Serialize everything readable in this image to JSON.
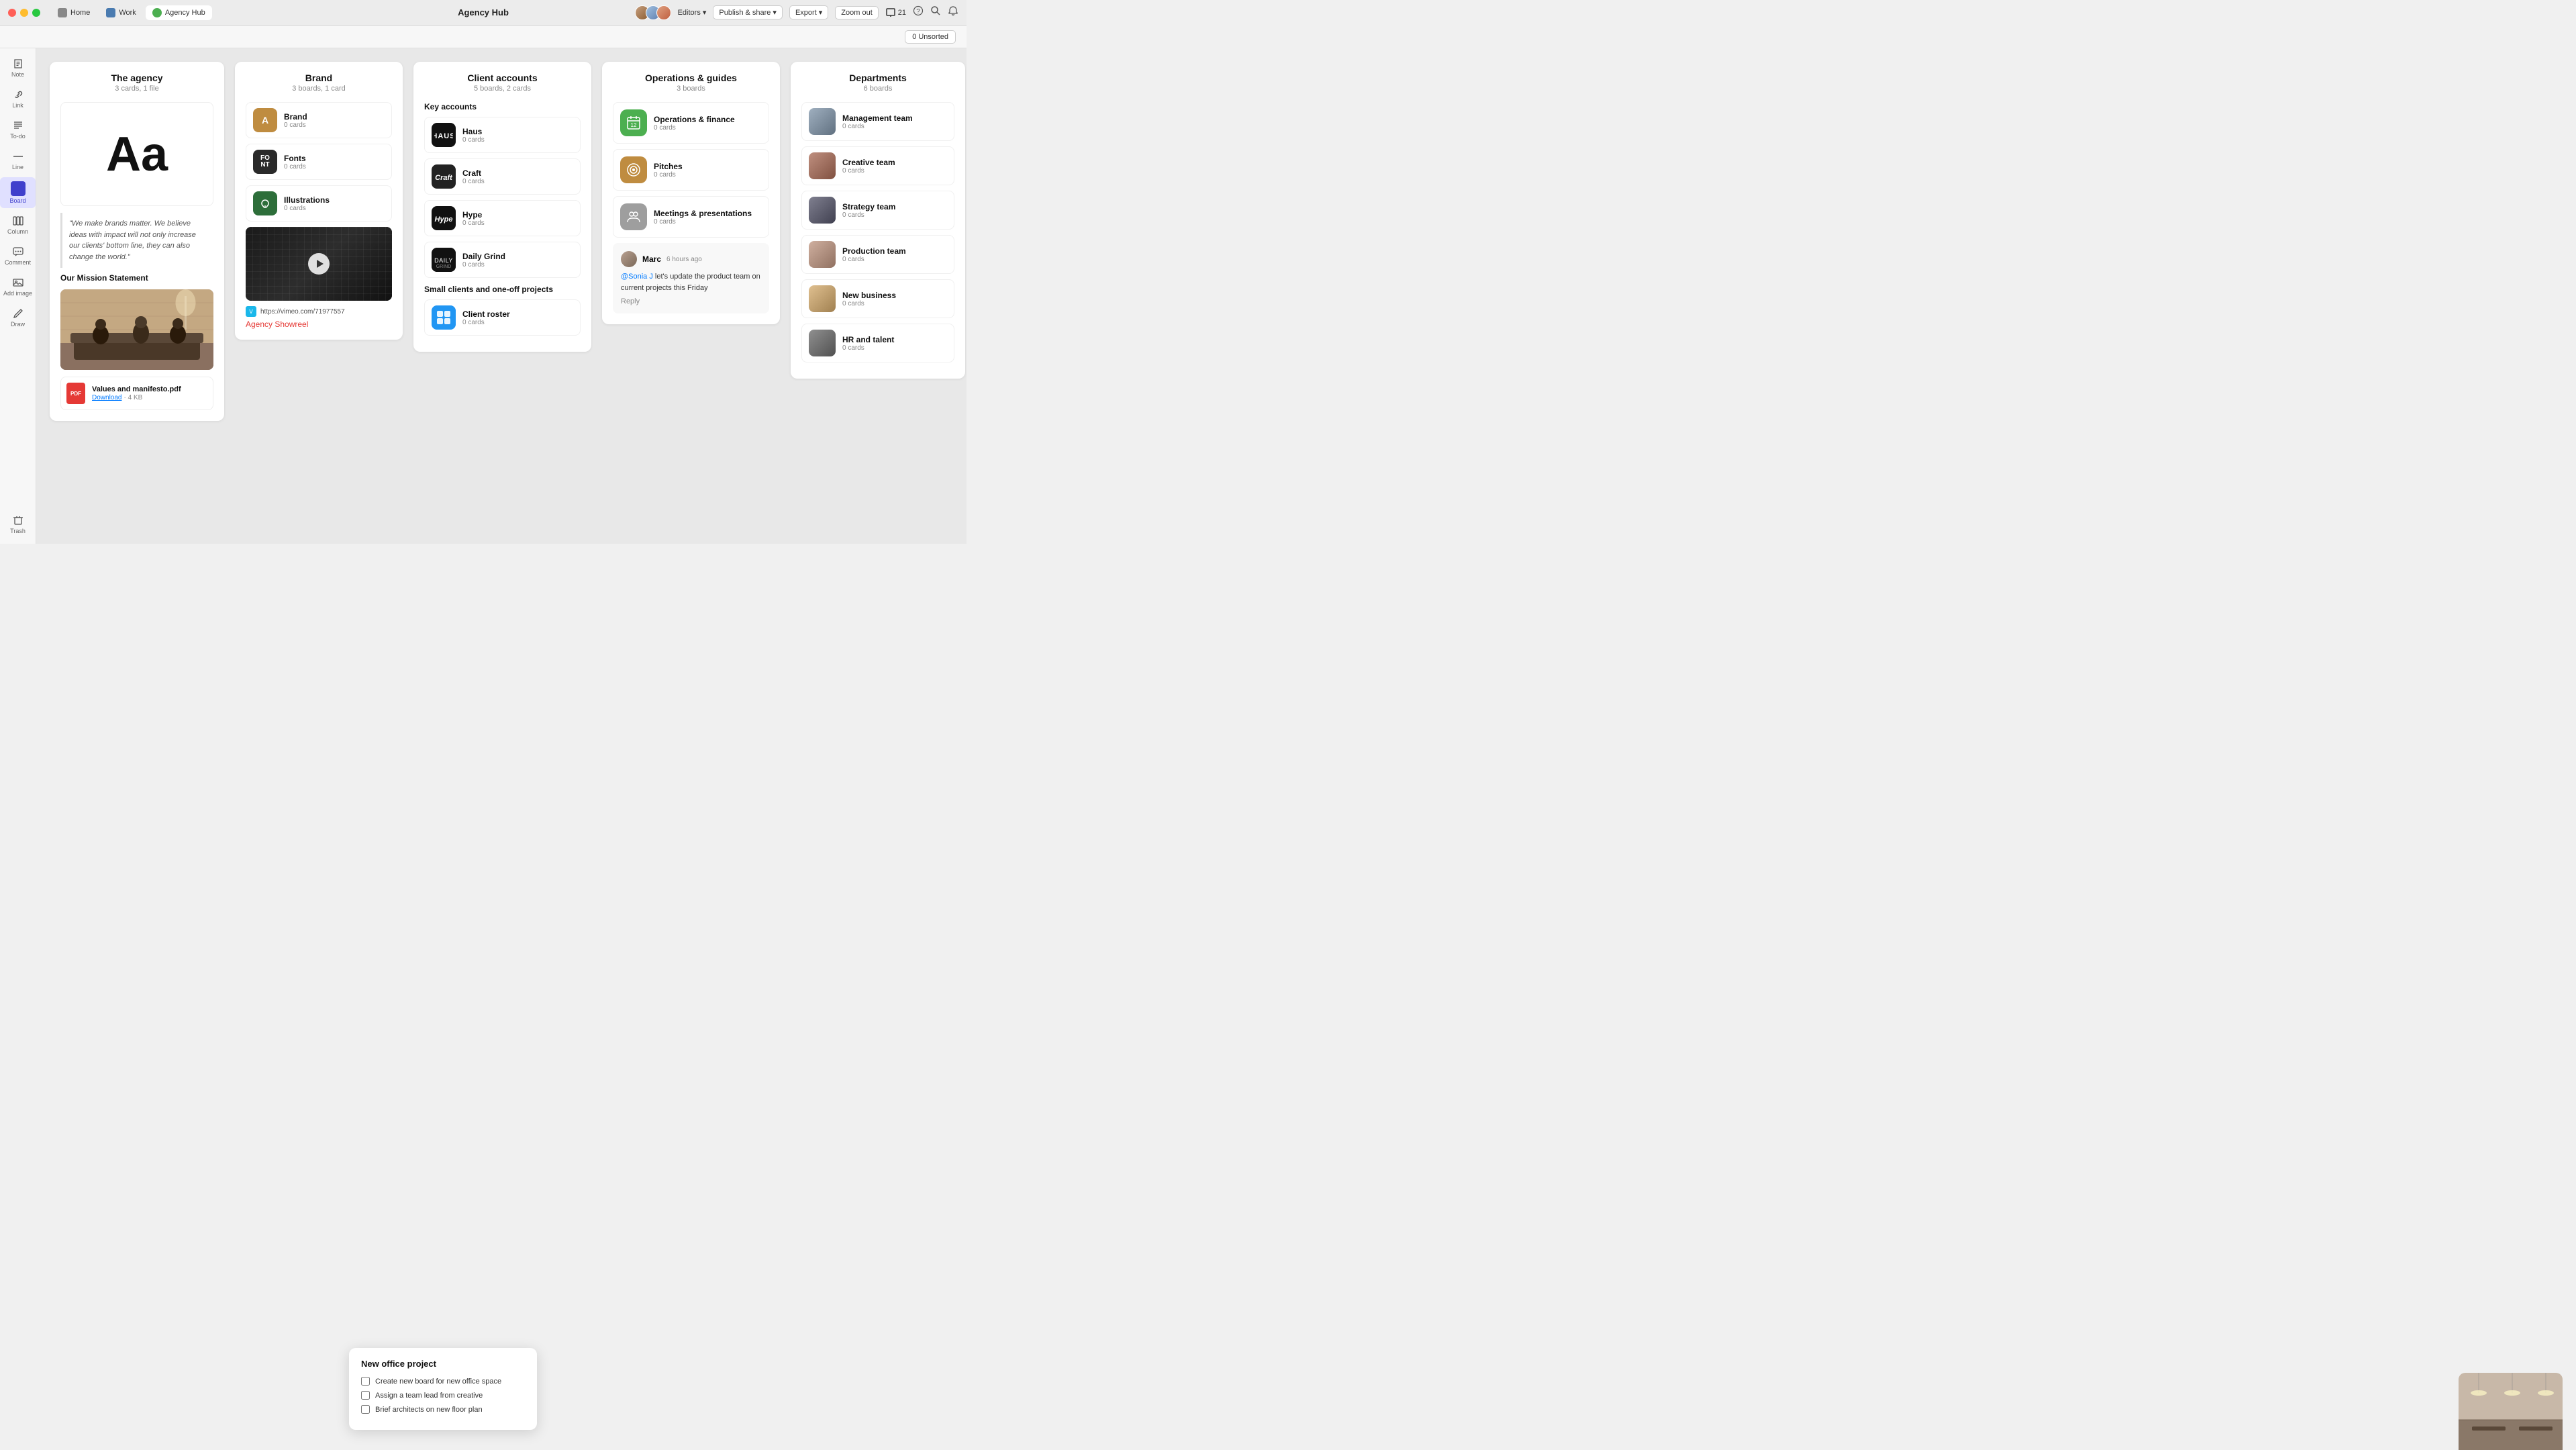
{
  "titleBar": {
    "title": "Agency Hub",
    "tabs": [
      {
        "label": "Home",
        "iconType": "home",
        "active": false
      },
      {
        "label": "Work",
        "iconType": "work",
        "active": false
      },
      {
        "label": "Agency Hub",
        "iconType": "agency",
        "active": true
      }
    ],
    "editors": "Editors",
    "publishShare": "Publish & share",
    "export": "Export",
    "zoomOut": "Zoom out",
    "notifications": "21"
  },
  "topBar": {
    "unsorted": "0 Unsorted"
  },
  "sidebar": {
    "items": [
      {
        "label": "Note",
        "icon": "note-icon"
      },
      {
        "label": "Link",
        "icon": "link-icon"
      },
      {
        "label": "To-do",
        "icon": "todo-icon"
      },
      {
        "label": "Line",
        "icon": "line-icon"
      },
      {
        "label": "Board",
        "icon": "board-icon",
        "active": true
      },
      {
        "label": "Column",
        "icon": "column-icon"
      },
      {
        "label": "Comment",
        "icon": "comment-icon"
      },
      {
        "label": "Add image",
        "icon": "add-image-icon"
      },
      {
        "label": "Draw",
        "icon": "draw-icon"
      },
      {
        "label": "Trash",
        "icon": "trash-icon"
      }
    ]
  },
  "columns": {
    "agency": {
      "title": "The agency",
      "subtitle": "3 cards, 1 file",
      "quote": "\"We make brands matter. We believe ideas with impact will not only increase our clients' bottom line, they can also change the world.\"",
      "missionLabel": "Our Mission Statement",
      "pdf": {
        "title": "Values and manifesto.pdf",
        "link": "Download",
        "size": "4 KB"
      }
    },
    "brand": {
      "title": "Brand",
      "subtitle": "3 boards, 1 card",
      "items": [
        {
          "label": "Brand",
          "sub": "0 cards",
          "iconBg": "#bf8c40"
        },
        {
          "label": "Fonts",
          "sub": "0 cards",
          "iconBg": "#2a2a2a"
        },
        {
          "label": "Illustrations",
          "sub": "0 cards",
          "iconBg": "#2d6e3a"
        }
      ],
      "videoLink": "https://vimeo.com/71977557",
      "showreel": "Agency Showreel"
    },
    "clientAccounts": {
      "title": "Client accounts",
      "subtitle": "5 boards, 2 cards",
      "sections": [
        {
          "heading": "Key accounts",
          "items": [
            {
              "label": "Haus",
              "sub": "0 cards",
              "iconBg": "#111"
            },
            {
              "label": "Craft",
              "sub": "0 cards",
              "iconBg": "#222"
            },
            {
              "label": "Hype",
              "sub": "0 cards",
              "iconBg": "#111"
            },
            {
              "label": "Daily Grind",
              "sub": "0 cards",
              "iconBg": "#111"
            }
          ]
        },
        {
          "heading": "Small clients and one-off projects",
          "items": [
            {
              "label": "Client roster",
              "sub": "0 cards",
              "iconBg": "#2196f3"
            }
          ]
        }
      ]
    },
    "operations": {
      "title": "Operations & guides",
      "subtitle": "3 boards",
      "items": [
        {
          "label": "Operations & finance",
          "sub": "0 cards",
          "iconBg": "#4caf50",
          "iconType": "calendar"
        },
        {
          "label": "Pitches",
          "sub": "0 cards",
          "iconBg": "#bf8c40",
          "iconType": "target"
        },
        {
          "label": "Meetings & presentations",
          "sub": "0 cards",
          "iconBg": "#9e9e9e",
          "iconType": "meeting"
        }
      ],
      "comment": {
        "author": "Marc",
        "time": "6 hours ago",
        "mention": "@Sonia J",
        "text": " let's update the product team on current projects this Friday",
        "reply": "Reply"
      }
    },
    "departments": {
      "title": "Departments",
      "subtitle": "6 boards",
      "items": [
        {
          "label": "Management team",
          "sub": "0 cards"
        },
        {
          "label": "Creative team",
          "sub": "0 cards"
        },
        {
          "label": "Strategy team",
          "sub": "0 cards"
        },
        {
          "label": "Production team",
          "sub": "0 cards"
        },
        {
          "label": "New business",
          "sub": "0 cards"
        },
        {
          "label": "HR and talent",
          "sub": "0 cards"
        }
      ]
    }
  },
  "newProject": {
    "title": "New office project",
    "tasks": [
      "Create new board for new office space",
      "Assign a team lead from creative",
      "Brief architects on new floor plan"
    ]
  }
}
